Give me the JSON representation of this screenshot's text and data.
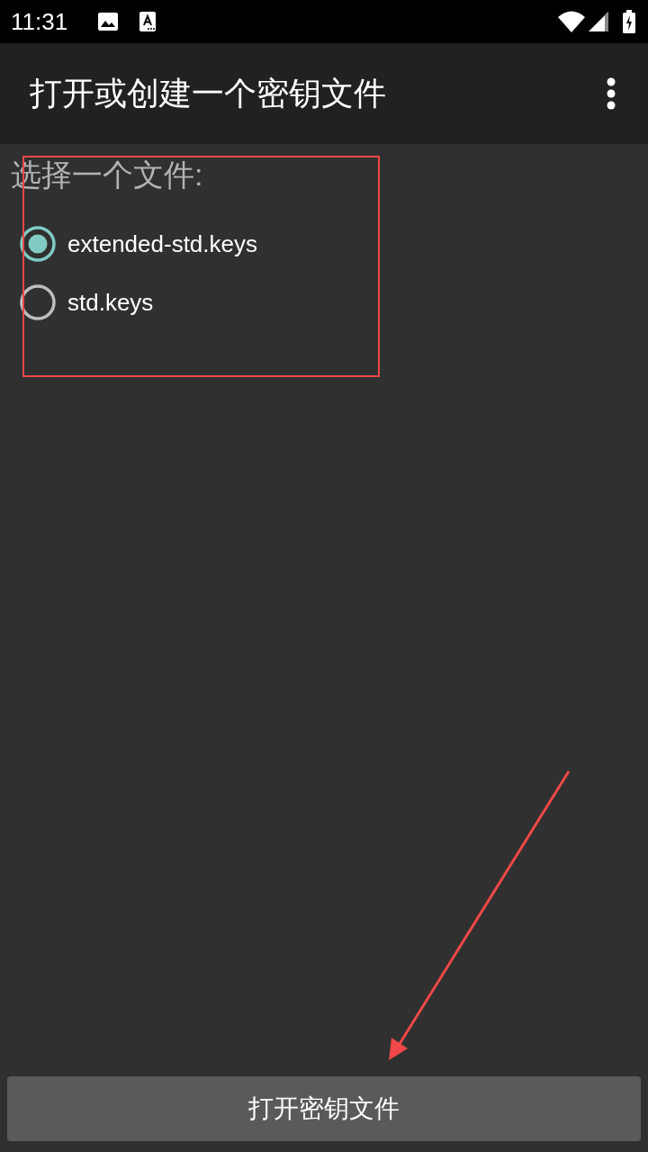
{
  "status_bar": {
    "time": "11:31"
  },
  "app_bar": {
    "title": "打开或创建一个密钥文件"
  },
  "file_picker": {
    "label": "选择一个文件:",
    "options": [
      {
        "label": "extended-std.keys",
        "selected": true
      },
      {
        "label": "std.keys",
        "selected": false
      }
    ]
  },
  "primary_button": {
    "label": "打开密钥文件"
  }
}
